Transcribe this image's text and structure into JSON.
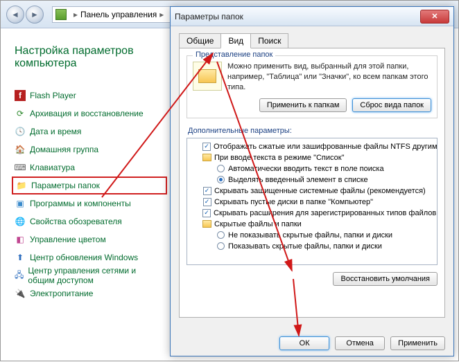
{
  "explorer": {
    "breadcrumb": "Панель управления",
    "title": "Настройка параметров компьютера"
  },
  "cp": {
    "items": [
      {
        "label": "Flash Player"
      },
      {
        "label": "Архивация и восстановление"
      },
      {
        "label": "Дата и время"
      },
      {
        "label": "Домашняя группа"
      },
      {
        "label": "Клавиатура"
      },
      {
        "label": "Параметры папок"
      },
      {
        "label": "Программы и компоненты"
      },
      {
        "label": "Свойства обозревателя"
      },
      {
        "label": "Управление цветом"
      },
      {
        "label": "Центр обновления Windows"
      },
      {
        "label": "Центр управления сетями и общим доступом"
      },
      {
        "label": "Электропитание"
      }
    ]
  },
  "dialog": {
    "title": "Параметры папок",
    "tabs": {
      "general": "Общие",
      "view": "Вид",
      "search": "Поиск"
    },
    "view_group_title": "Представление папок",
    "view_group_text": "Можно применить вид, выбранный для этой папки, например, \"Таблица\" или \"Значки\", ко всем папкам этого типа.",
    "apply_to_folders": "Применить к папкам",
    "reset_folders": "Сброс вида папок",
    "advanced_label": "Дополнительные параметры:",
    "tree": [
      {
        "kind": "check",
        "checked": true,
        "indent": 20,
        "label": "Отображать сжатые или зашифрованные файлы NTFS другим цветом"
      },
      {
        "kind": "folder",
        "indent": 20,
        "label": "При вводе текста в режиме \"Список\""
      },
      {
        "kind": "radio",
        "checked": false,
        "indent": 40,
        "label": "Автоматически вводить текст в поле поиска"
      },
      {
        "kind": "radio",
        "checked": true,
        "indent": 40,
        "label": "Выделять введенный элемент в списке"
      },
      {
        "kind": "check",
        "checked": true,
        "indent": 20,
        "label": "Скрывать защищенные системные файлы (рекомендуется)"
      },
      {
        "kind": "check",
        "checked": true,
        "indent": 20,
        "label": "Скрывать пустые диски в папке \"Компьютер\""
      },
      {
        "kind": "check",
        "checked": true,
        "indent": 20,
        "label": "Скрывать расширения для зарегистрированных типов файлов"
      },
      {
        "kind": "folder",
        "indent": 20,
        "label": "Скрытые файлы и папки"
      },
      {
        "kind": "radio",
        "checked": false,
        "indent": 40,
        "label": "Не показывать скрытые файлы, папки и диски"
      },
      {
        "kind": "radio",
        "checked": false,
        "indent": 40,
        "label": "Показывать скрытые файлы, папки и диски"
      }
    ],
    "restore_defaults": "Восстановить умолчания",
    "ok": "ОК",
    "cancel": "Отмена",
    "apply": "Применить"
  }
}
